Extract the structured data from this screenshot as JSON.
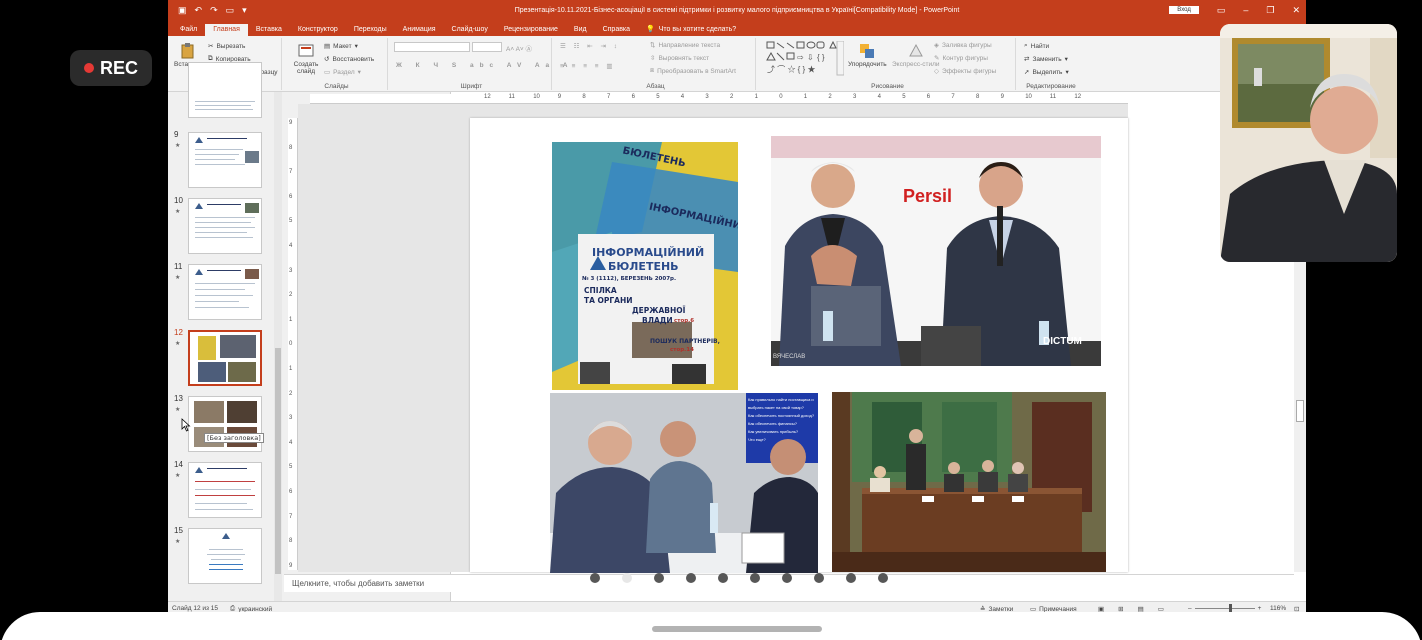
{
  "recording": {
    "label": "REC"
  },
  "window": {
    "title": "Презентація-10.11.2021-Бізнес-асоціації в системі підтримки і розвитку малого підприємництва в Україні[Compatibility Mode]  -  PowerPoint",
    "sign_in": "Вход"
  },
  "tabs": [
    "Файл",
    "Главная",
    "Вставка",
    "Конструктор",
    "Переходы",
    "Анимация",
    "Слайд-шоу",
    "Рецензирование",
    "Вид",
    "Справка"
  ],
  "tell_me": "Что вы хотите сделать?",
  "ribbon": {
    "clipboard": {
      "paste": "Вставить",
      "cut": "Вырезать",
      "copy": "Копировать",
      "format": "Формат по образцу",
      "label": "Буфер обмена"
    },
    "slides": {
      "new_slide": "Создать слайд",
      "layout": "Макет",
      "reset": "Восстановить",
      "section": "Раздел",
      "label": "Слайды"
    },
    "font": {
      "label": "Шрифт"
    },
    "paragraph": {
      "text_direction": "Направление текста",
      "align_text": "Выровнять текст",
      "smartart": "Преобразовать в SmartArt",
      "label": "Абзац"
    },
    "drawing": {
      "arrange": "Упорядочить",
      "quick_styles": "Экспресс-стили",
      "fill": "Заливка фигуры",
      "outline": "Контур фигуры",
      "effects": "Эффекты фигуры",
      "label": "Рисование"
    },
    "editing": {
      "find": "Найти",
      "replace": "Заменить",
      "select": "Выделить",
      "label": "Редактирование"
    }
  },
  "thumbnails": [
    {
      "num": "9"
    },
    {
      "num": "10"
    },
    {
      "num": "11"
    },
    {
      "num": "12",
      "selected": true
    },
    {
      "num": "13",
      "tooltip": "[Без заголовка]"
    },
    {
      "num": "14"
    },
    {
      "num": "15"
    }
  ],
  "ruler_h": [
    "12",
    "11",
    "10",
    "9",
    "8",
    "7",
    "6",
    "5",
    "4",
    "3",
    "2",
    "1",
    "0",
    "1",
    "2",
    "3",
    "4",
    "5",
    "6",
    "7",
    "8",
    "9",
    "10",
    "11",
    "12"
  ],
  "ruler_v": [
    "9",
    "8",
    "7",
    "6",
    "5",
    "4",
    "3",
    "2",
    "1",
    "0",
    "1",
    "2",
    "3",
    "4",
    "5",
    "6",
    "7",
    "8",
    "9"
  ],
  "slide": {
    "photo1": {
      "bulletin_title": "ІНФОРМАЦІЙНИЙ",
      "bulletin_sub": "БЮЛЕТЕНЬ",
      "issue": "№ 3 (1112), БЕРЕЗЕНЬ 2007р.",
      "headline_1": "СПІЛКА",
      "headline_2": "ТА ОРГАНИ",
      "headline_3": "ДЕРЖАВНОЇ",
      "headline_4": "ВЛАДИ",
      "page_ref": "стор.6",
      "partners": "ПОШУК ПАРТНЕРІВ,",
      "partners_ref": "стор.14"
    },
    "photo2": {
      "brand": "Persil",
      "watermark": "DICTUM",
      "caption": "ВЯЧЕСЛАВ"
    },
    "photo3": {
      "screen_lines": [
        "Как правильно найти поставщика и выбрать пакет на свой товар?",
        "Как обеспечить постоянный доход?",
        "Как обеспечить финансы?",
        "Как увеличивать прибыль?",
        "Что еще?"
      ]
    }
  },
  "slide_dots": 10,
  "slide_dot_active": 1,
  "notes_placeholder": "Щелкните, чтобы добавить заметки",
  "status": {
    "slide_of": "Слайд 12 из 15",
    "language": "украинский",
    "notes": "Заметки",
    "comments": "Примечания",
    "zoom": "116%"
  }
}
